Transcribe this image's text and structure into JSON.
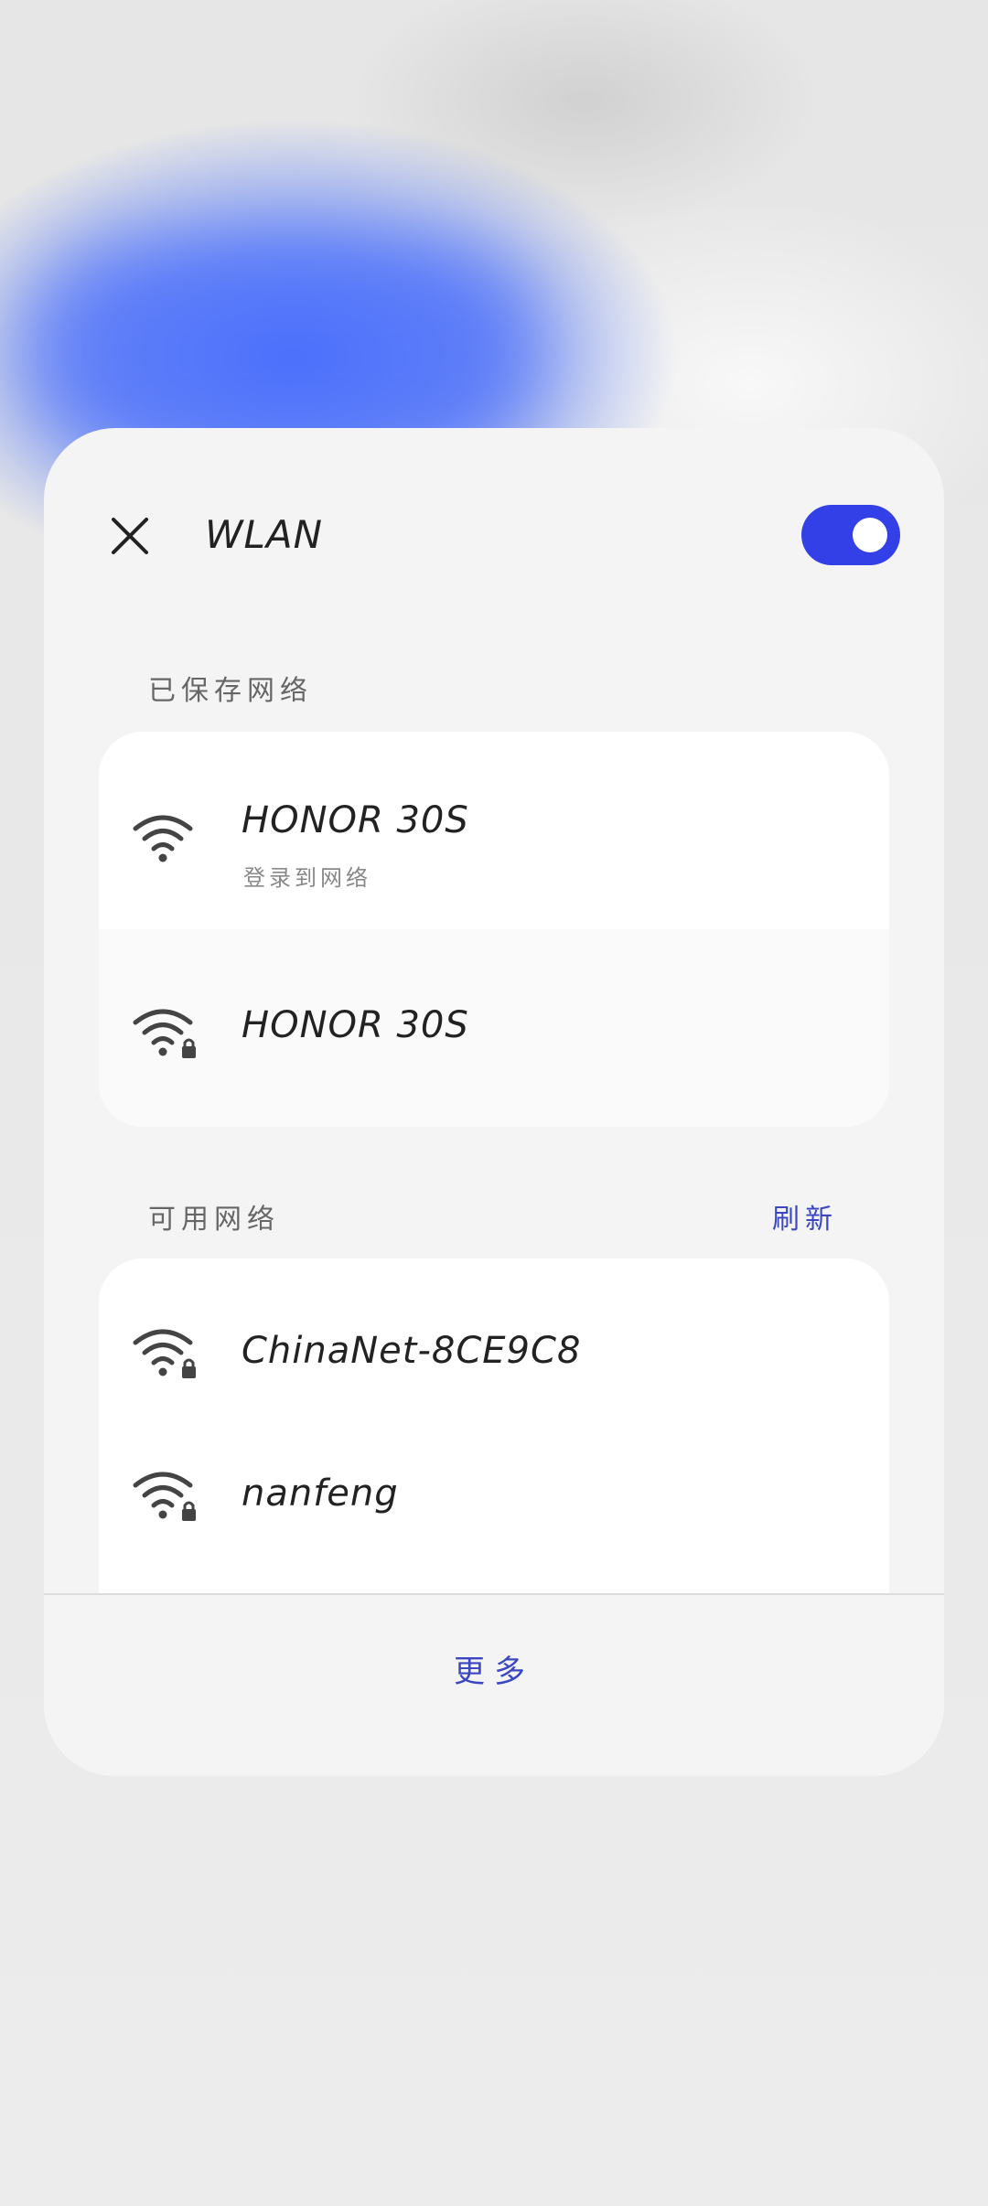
{
  "panel": {
    "title": "WLAN",
    "toggle_on": true,
    "accent_color": "#3340e8"
  },
  "saved_section": {
    "label": "已保存网络",
    "items": [
      {
        "name": "HONOR 30S",
        "status": "登录到网络",
        "icon": "wifi-icon"
      },
      {
        "name": "HONOR 30S",
        "icon": "wifi-lock-icon"
      }
    ]
  },
  "available_section": {
    "label": "可用网络",
    "refresh_label": "刷新",
    "items": [
      {
        "name": "ChinaNet-8CE9C8",
        "icon": "wifi-lock-icon"
      },
      {
        "name": "nanfeng",
        "icon": "wifi-lock-icon"
      }
    ]
  },
  "footer": {
    "more_label": "更多"
  }
}
